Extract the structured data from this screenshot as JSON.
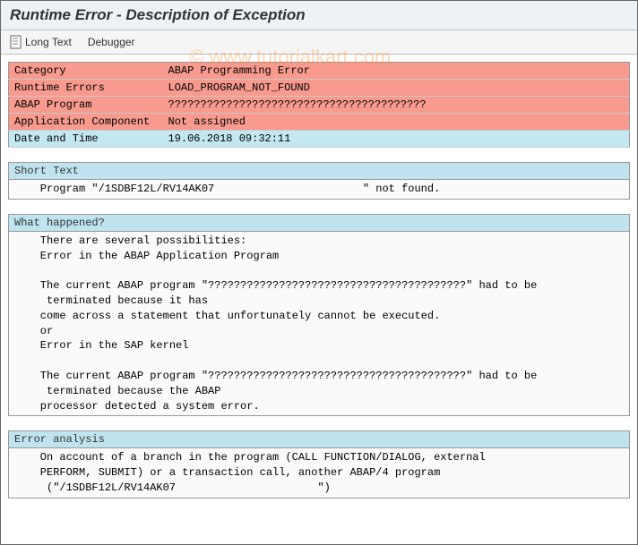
{
  "title": "Runtime Error - Description of Exception",
  "toolbar": {
    "long_text_label": "Long Text",
    "debugger_label": "Debugger"
  },
  "info_rows": [
    {
      "label": "Category",
      "value": "ABAP Programming Error",
      "style": "red"
    },
    {
      "label": "Runtime Errors",
      "value": "LOAD_PROGRAM_NOT_FOUND",
      "style": "red"
    },
    {
      "label": "ABAP Program",
      "value": "????????????????????????????????????????",
      "style": "red"
    },
    {
      "label": "Application Component",
      "value": "Not assigned",
      "style": "red"
    },
    {
      "label": "Date and Time",
      "value": "19.06.2018 09:32:11",
      "style": "blue"
    }
  ],
  "short_text": {
    "header": "Short Text",
    "lines": [
      "    Program \"/1SDBF12L/RV14AK07                       \" not found."
    ]
  },
  "what_happened": {
    "header": "What happened?",
    "lines": [
      "    There are several possibilities:",
      "    Error in the ABAP Application Program",
      "",
      "    The current ABAP program \"????????????????????????????????????????\" had to be",
      "     terminated because it has",
      "    come across a statement that unfortunately cannot be executed.",
      "    or",
      "    Error in the SAP kernel",
      "",
      "    The current ABAP program \"????????????????????????????????????????\" had to be",
      "     terminated because the ABAP",
      "    processor detected a system error."
    ]
  },
  "error_analysis": {
    "header": "Error analysis",
    "lines": [
      "    On account of a branch in the program (CALL FUNCTION/DIALOG, external",
      "    PERFORM, SUBMIT) or a transaction call, another ABAP/4 program",
      "     (\"/1SDBF12L/RV14AK07                      \")"
    ]
  },
  "watermark": "© www.tutorialkart.com"
}
